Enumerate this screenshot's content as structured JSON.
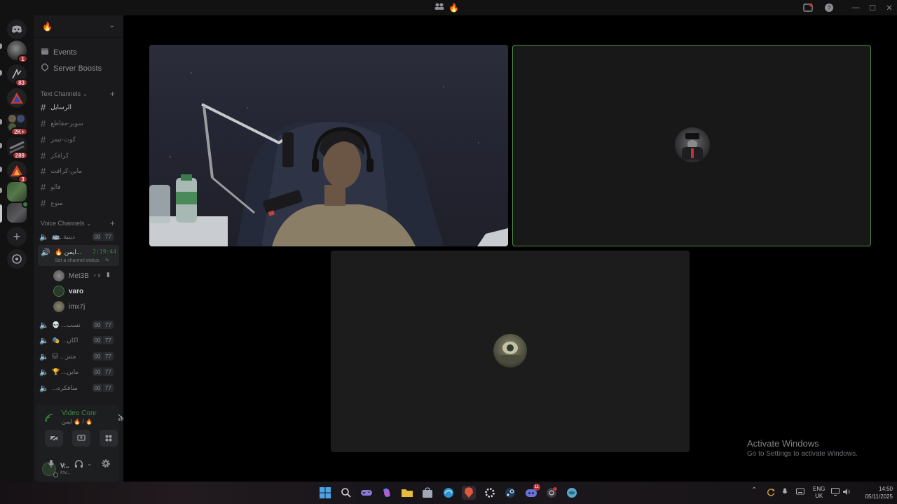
{
  "window": {
    "title_icons": [
      "users-icon",
      "fire-emoji"
    ],
    "fire": "🔥",
    "controls": [
      "inbox-icon",
      "help-icon",
      "minimize-icon",
      "maximize-icon",
      "close-icon"
    ]
  },
  "server": {
    "name": "🔥",
    "nav": [
      {
        "label": "Events",
        "icon": "calendar-icon"
      },
      {
        "label": "Server Boosts",
        "icon": "boost-icon"
      }
    ],
    "text_category": "Text Channels",
    "text_channels": [
      "الرسايل",
      "سوير-مقاطع",
      "كوت-تيمز",
      "كرافكر",
      "ماين-كرافت",
      "فالو",
      "متوع"
    ],
    "voice_category": "Voice Channels",
    "voice_channels": [
      {
        "name": "🚌..دينية",
        "count_a": "00",
        "count_b": "77"
      },
      {
        "name": "🔥 ايمن...",
        "timer": "2:19:44",
        "status": "Set a channel status"
      },
      {
        "name": "💀 ...تسب",
        "count_a": "00",
        "count_b": "77"
      },
      {
        "name": "🎭 ...اكان",
        "count_a": "00",
        "count_b": "77"
      },
      {
        "name": "🐱 ...متنز",
        "count_a": "00",
        "count_b": "77"
      },
      {
        "name": "🏆 ...ماين",
        "count_a": "00",
        "count_b": "77"
      },
      {
        "name": "...منافكره",
        "count_a": "00",
        "count_b": "77"
      }
    ],
    "voice_users": [
      {
        "name": "Met3B",
        "extra": "⚡ 8"
      },
      {
        "name": "varo"
      },
      {
        "name": "imx7j"
      }
    ]
  },
  "guild_badges": [
    "1",
    "83",
    "2K+",
    "289",
    "3"
  ],
  "voice_panel": {
    "status": "Video Connecte",
    "subtitle": "ايمن 🔥 / 🔥",
    "user_name": "V...",
    "user_status": "Inv..."
  },
  "watermark": {
    "line1": "Activate Windows",
    "line2": "Go to Settings to activate Windows."
  },
  "taskbar": {
    "lang1": "ENG",
    "lang2": "UK",
    "time": "14:50",
    "date": "05/11/2025",
    "discord_badge": "11"
  },
  "colors": {
    "accent_green": "#3f7a3f",
    "speaking_border": "#4f8a48",
    "badge_red": "#a12b2f"
  }
}
